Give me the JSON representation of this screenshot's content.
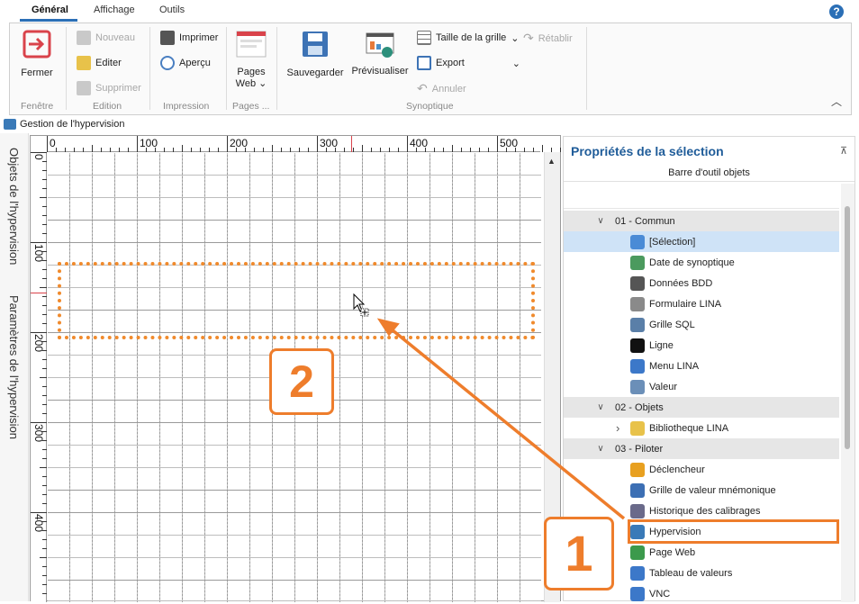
{
  "tabs": [
    "Général",
    "Affichage",
    "Outils"
  ],
  "help_label": "?",
  "ribbon": {
    "fermer": "Fermer",
    "nouveau": "Nouveau",
    "editer": "Editer",
    "supprimer": "Supprimer",
    "imprimer": "Imprimer",
    "apercu": "Aperçu",
    "pages_web": "Pages",
    "pages_web2": "Web",
    "sauvegarder": "Sauvegarder",
    "previsualiser": "Prévisualiser",
    "taille_grille": "Taille de la grille",
    "export": "Export",
    "retablir": "Rétablir",
    "annuler": "Annuler",
    "groups": {
      "fenetre": "Fenêtre",
      "edition": "Edition",
      "impression": "Impression",
      "pages": "Pages ...",
      "synoptique": "Synoptique"
    }
  },
  "doc_tab": "Gestion de l'hypervision",
  "left_panel": {
    "objets": "Objets de l'hypervision",
    "parametres": "Paramètres de l'hypervision"
  },
  "ruler": {
    "top": [
      "0",
      "100",
      "200",
      "300",
      "400",
      "500"
    ],
    "left": [
      "0",
      "100",
      "200",
      "300",
      "400"
    ]
  },
  "callouts": {
    "one": "1",
    "two": "2"
  },
  "right_panel": {
    "title": "Propriétés de la sélection",
    "pin": "⊼",
    "subtitle": "Barre d'outil objets",
    "items": [
      {
        "type": "cat",
        "label": "01 - Commun",
        "chev": "∨"
      },
      {
        "type": "item",
        "label": "[Sélection]",
        "icon": "cursor-icon",
        "color": "#4a8bd6",
        "selected": true
      },
      {
        "type": "item",
        "label": "Date de synoptique",
        "icon": "calendar-icon",
        "color": "#4b9a5e"
      },
      {
        "type": "item",
        "label": "Données BDD",
        "icon": "database-icon",
        "color": "#555555"
      },
      {
        "type": "item",
        "label": "Formulaire LINA",
        "icon": "form-icon",
        "color": "#8a8a8a"
      },
      {
        "type": "item",
        "label": "Grille SQL",
        "icon": "grid-icon",
        "color": "#5a7fa8"
      },
      {
        "type": "item",
        "label": "Ligne",
        "icon": "line-icon",
        "color": "#111111"
      },
      {
        "type": "item",
        "label": "Menu LINA",
        "icon": "menu-icon",
        "color": "#3c78c9"
      },
      {
        "type": "item",
        "label": "Valeur",
        "icon": "value-icon",
        "color": "#6b8fb8"
      },
      {
        "type": "cat",
        "label": "02 - Objets",
        "chev": "∨"
      },
      {
        "type": "item",
        "label": "Bibliotheque LINA",
        "icon": "folder-icon",
        "color": "#e8c24a",
        "chev": "›"
      },
      {
        "type": "cat",
        "label": "03 - Piloter",
        "chev": "∨"
      },
      {
        "type": "item",
        "label": "Déclencheur",
        "icon": "lightning-icon",
        "color": "#e8a020"
      },
      {
        "type": "item",
        "label": "Grille de valeur mnémonique",
        "icon": "mnemonic-icon",
        "color": "#3c6fb4"
      },
      {
        "type": "item",
        "label": "Historique des calibrages",
        "icon": "history-icon",
        "color": "#6a6a8a"
      },
      {
        "type": "item",
        "label": "Hypervision",
        "icon": "hypervision-icon",
        "color": "#3a7ab8",
        "highlight": true
      },
      {
        "type": "item",
        "label": "Page Web",
        "icon": "globe-icon",
        "color": "#3c9a4c"
      },
      {
        "type": "item",
        "label": "Tableau de valeurs",
        "icon": "table-icon",
        "color": "#3c78c9"
      },
      {
        "type": "item",
        "label": "VNC",
        "icon": "vnc-icon",
        "color": "#3c78c9"
      }
    ]
  }
}
